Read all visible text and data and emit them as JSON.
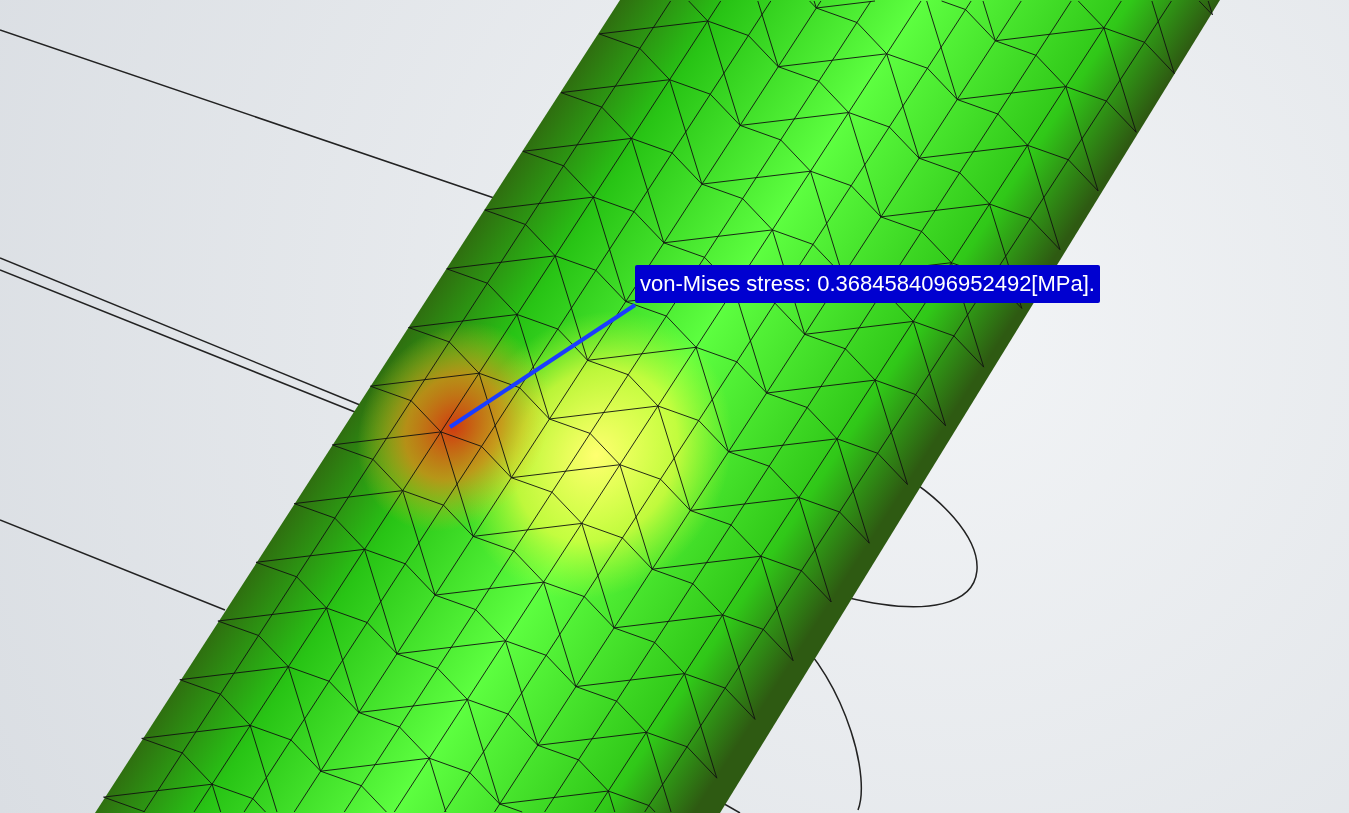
{
  "annotation": {
    "text": "von-Mises stress: 0.3684584096952492[MPa]."
  }
}
